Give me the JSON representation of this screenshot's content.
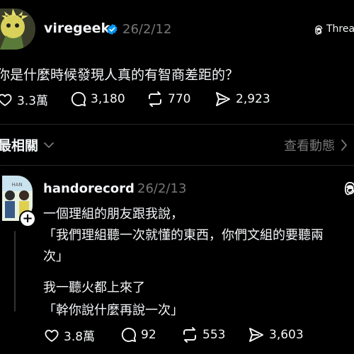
{
  "post": {
    "username": "viregeek",
    "date": "26/2/12",
    "app_label": "Threads",
    "text": "你是什麼時候發現人真的有智商差距的？",
    "stats": {
      "likes": "3.3萬",
      "replies": "3,180",
      "reposts": "770",
      "shares": "2,923"
    }
  },
  "sort_bar": {
    "sort_label": "最相關",
    "view_activity": "查看動態"
  },
  "reply": {
    "username": "handorecord",
    "date": "26/2/13",
    "lines": [
      "一個理組的朋友跟我說，",
      "「我們理組聽一次就懂的東西，你們文組的要聽兩",
      "次」",
      "我一聽火都上來了",
      "「幹你說什麼再說一次」"
    ],
    "stats": {
      "likes": "3.8萬",
      "replies": "92",
      "reposts": "553",
      "shares": "3,603"
    }
  },
  "colors": {
    "background": "#000000",
    "text": "#f3f5f7",
    "muted": "#777777",
    "verified": "#0095f6"
  }
}
